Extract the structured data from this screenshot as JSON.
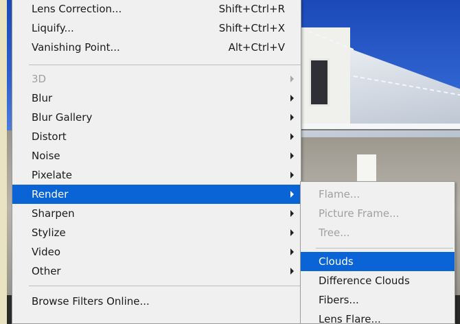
{
  "filter_menu": {
    "items": [
      {
        "label": "Lens Correction...",
        "shortcut": "Shift+Ctrl+R",
        "has_submenu": false,
        "enabled": true,
        "highlighted": false
      },
      {
        "label": "Liquify...",
        "shortcut": "Shift+Ctrl+X",
        "has_submenu": false,
        "enabled": true,
        "highlighted": false
      },
      {
        "label": "Vanishing Point...",
        "shortcut": "Alt+Ctrl+V",
        "has_submenu": false,
        "enabled": true,
        "highlighted": false
      },
      {
        "label": "3D",
        "shortcut": "",
        "has_submenu": true,
        "enabled": false,
        "highlighted": false
      },
      {
        "label": "Blur",
        "shortcut": "",
        "has_submenu": true,
        "enabled": true,
        "highlighted": false
      },
      {
        "label": "Blur Gallery",
        "shortcut": "",
        "has_submenu": true,
        "enabled": true,
        "highlighted": false
      },
      {
        "label": "Distort",
        "shortcut": "",
        "has_submenu": true,
        "enabled": true,
        "highlighted": false
      },
      {
        "label": "Noise",
        "shortcut": "",
        "has_submenu": true,
        "enabled": true,
        "highlighted": false
      },
      {
        "label": "Pixelate",
        "shortcut": "",
        "has_submenu": true,
        "enabled": true,
        "highlighted": false
      },
      {
        "label": "Render",
        "shortcut": "",
        "has_submenu": true,
        "enabled": true,
        "highlighted": true
      },
      {
        "label": "Sharpen",
        "shortcut": "",
        "has_submenu": true,
        "enabled": true,
        "highlighted": false
      },
      {
        "label": "Stylize",
        "shortcut": "",
        "has_submenu": true,
        "enabled": true,
        "highlighted": false
      },
      {
        "label": "Video",
        "shortcut": "",
        "has_submenu": true,
        "enabled": true,
        "highlighted": false
      },
      {
        "label": "Other",
        "shortcut": "",
        "has_submenu": true,
        "enabled": true,
        "highlighted": false
      },
      {
        "label": "Browse Filters Online...",
        "shortcut": "",
        "has_submenu": false,
        "enabled": true,
        "highlighted": false
      }
    ]
  },
  "render_submenu": {
    "items": [
      {
        "label": "Flame...",
        "enabled": false,
        "highlighted": false
      },
      {
        "label": "Picture Frame...",
        "enabled": false,
        "highlighted": false
      },
      {
        "label": "Tree...",
        "enabled": false,
        "highlighted": false
      },
      {
        "label": "Clouds",
        "enabled": true,
        "highlighted": true
      },
      {
        "label": "Difference Clouds",
        "enabled": true,
        "highlighted": false
      },
      {
        "label": "Fibers...",
        "enabled": true,
        "highlighted": false
      },
      {
        "label": "Lens Flare...",
        "enabled": true,
        "highlighted": false
      }
    ]
  },
  "colors": {
    "menu_background": "#f0f0f0",
    "highlight": "#0a64d6",
    "text": "#1a1a1a",
    "disabled_text": "#a0a0a0"
  }
}
